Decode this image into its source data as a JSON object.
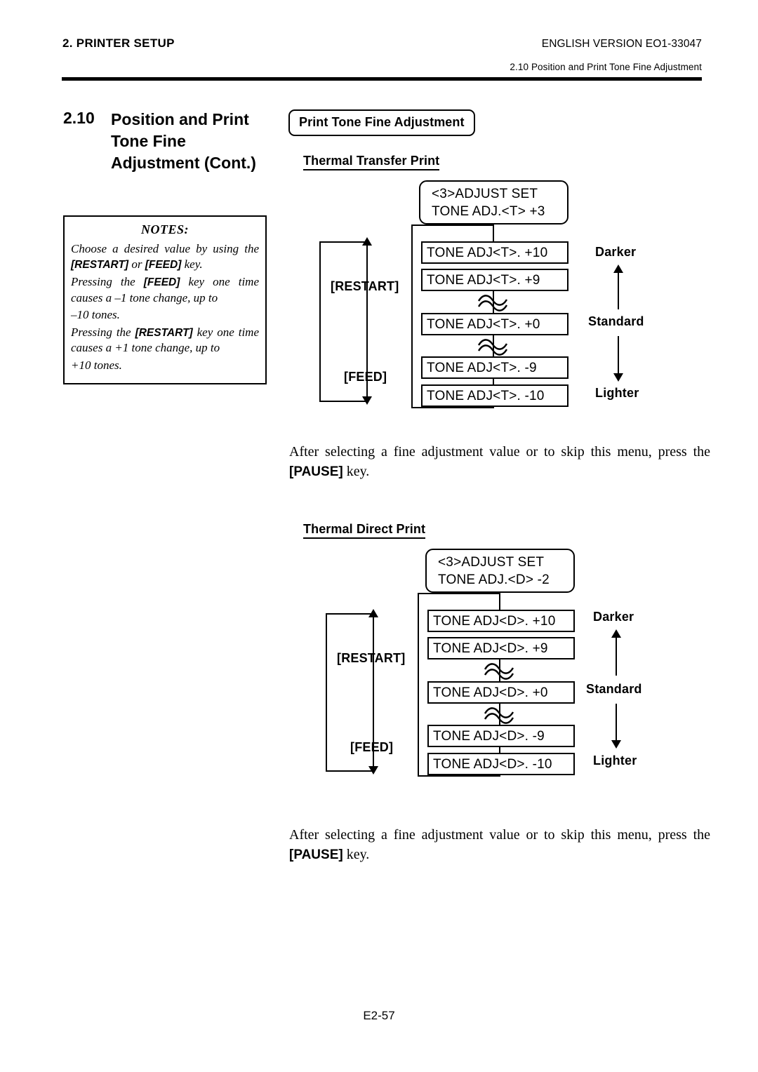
{
  "header": {
    "left": "2. PRINTER SETUP",
    "right": "ENGLISH VERSION EO1-33047",
    "sub": "2.10 Position and Print Tone Fine Adjustment"
  },
  "section": {
    "number": "2.10",
    "title_line1": "Position and Print",
    "title_line2": "Tone Fine",
    "title_line3": "Adjustment (Cont.)"
  },
  "notes": {
    "title": "NOTES:",
    "p1_a": "Choose a desired value by using the ",
    "p1_b": "[RESTART]",
    "p1_c": " or ",
    "p1_d": "[FEED]",
    "p1_e": " key.",
    "p2_a": "Pressing the ",
    "p2_b": "[FEED]",
    "p2_c": " key one time causes a –1 tone change, up to",
    "p2_d": "–10 tones.",
    "p3_a": "Pressing the ",
    "p3_b": "[RESTART]",
    "p3_c": " key one time causes a +1 tone change, up to",
    "p3_d": "+10 tones."
  },
  "caption_box": "Print Tone Fine Adjustment",
  "diagram1": {
    "heading": "Thermal Transfer Print",
    "lcd_line1": "<3>ADJUST SET",
    "lcd_line2": "TONE ADJ.<T> +3",
    "key_up": "[RESTART]",
    "key_down": "[FEED]",
    "rows": [
      "TONE ADJ<T>. +10",
      "TONE ADJ<T>. +9",
      "TONE ADJ<T>. +0",
      "TONE ADJ<T>. -9",
      "TONE ADJ<T>. -10"
    ],
    "scale_top": "Darker",
    "scale_mid": "Standard",
    "scale_bottom": "Lighter"
  },
  "diagram2": {
    "heading": "Thermal Direct Print",
    "lcd_line1": "<3>ADJUST SET",
    "lcd_line2": "TONE ADJ.<D> -2",
    "key_up": "[RESTART]",
    "key_down": "[FEED]",
    "rows": [
      "TONE ADJ<D>. +10",
      "TONE ADJ<D>. +9",
      "TONE ADJ<D>. +0",
      "TONE ADJ<D>. -9",
      "TONE ADJ<D>. -10"
    ],
    "scale_top": "Darker",
    "scale_mid": "Standard",
    "scale_bottom": "Lighter"
  },
  "paragraph1": {
    "a": "After selecting a fine adjustment value or to skip this menu, press the ",
    "b": "[PAUSE]",
    "c": " key."
  },
  "paragraph2": {
    "a": "After selecting a fine adjustment value or to skip this menu, press the ",
    "b": "[PAUSE]",
    "c": " key."
  },
  "footer": "E2-57"
}
